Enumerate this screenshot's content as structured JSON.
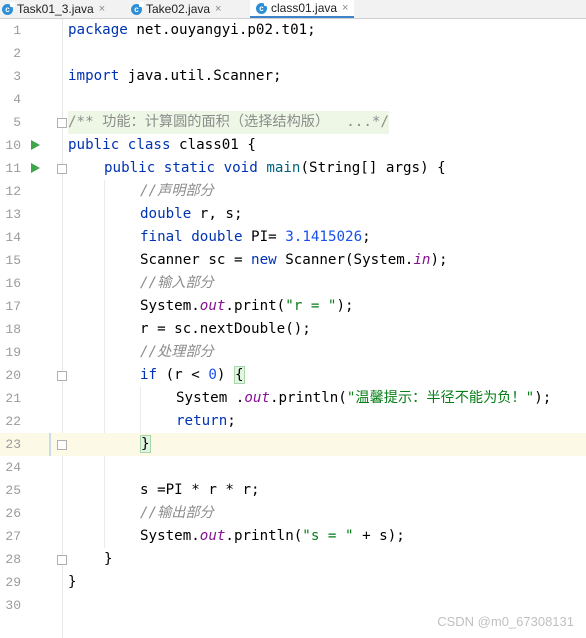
{
  "tabs": [
    {
      "label": "Task01_3.java",
      "icon": "java-class-icon",
      "active": false
    },
    {
      "label": "Take02.java",
      "icon": "java-class-icon",
      "active": false
    },
    {
      "label": "class01.java",
      "icon": "java-class-icon",
      "active": true
    }
  ],
  "tab_close_glyph": "×",
  "class_icon_glyph": "c",
  "lines": [
    {
      "n": "1"
    },
    {
      "n": "2"
    },
    {
      "n": "3"
    },
    {
      "n": "4"
    },
    {
      "n": "5"
    },
    {
      "n": "10"
    },
    {
      "n": "11"
    },
    {
      "n": "12"
    },
    {
      "n": "13"
    },
    {
      "n": "14"
    },
    {
      "n": "15"
    },
    {
      "n": "16"
    },
    {
      "n": "17"
    },
    {
      "n": "18"
    },
    {
      "n": "19"
    },
    {
      "n": "20"
    },
    {
      "n": "21"
    },
    {
      "n": "22"
    },
    {
      "n": "23"
    },
    {
      "n": "24"
    },
    {
      "n": "25"
    },
    {
      "n": "26"
    },
    {
      "n": "27"
    },
    {
      "n": "28"
    },
    {
      "n": "29"
    },
    {
      "n": "30"
    }
  ],
  "code": {
    "l1": {
      "kw": "package",
      "rest": " net.ouyangyi.p02.t01;"
    },
    "l3": {
      "kw": "import",
      "rest": " java.util.Scanner;"
    },
    "l5": {
      "text": "/** 功能：计算圆的面积（选择结构版）  ...*/"
    },
    "l10": {
      "kw1": "public",
      "kw2": "class",
      "rest": " class01 {"
    },
    "l11": {
      "kw1": "public",
      "kw2": "static",
      "kw3": "void",
      "method": "main",
      "rest": "(String[] args) {"
    },
    "l12": {
      "comment": "//声明部分"
    },
    "l13": {
      "kw": "double",
      "rest": " r, s;"
    },
    "l14": {
      "kw1": "final",
      "kw2": "double",
      "mid": " PI= ",
      "num": "3.1415026",
      "end": ";"
    },
    "l15": {
      "a": "Scanner sc = ",
      "kw": "new",
      "b": " Scanner(System.",
      "field": "in",
      "c": ");"
    },
    "l16": {
      "comment": "//输入部分"
    },
    "l17": {
      "a": "System.",
      "field": "out",
      "b": ".print(",
      "str": "\"r = \"",
      "c": ");"
    },
    "l18": {
      "text": "r = sc.nextDouble();"
    },
    "l19": {
      "comment": "//处理部分"
    },
    "l20": {
      "kw": "if",
      "a": " (r < ",
      "num": "0",
      "b": ") ",
      "brace": "{"
    },
    "l21": {
      "a": "System .",
      "field": "out",
      "b": ".println(",
      "str": "\"温馨提示：半径不能为负！\"",
      "c": ");"
    },
    "l22": {
      "kw": "return",
      "c": ";"
    },
    "l23": {
      "brace": "}"
    },
    "l25": {
      "text": "s =PI * r * r;"
    },
    "l26": {
      "comment": "//输出部分"
    },
    "l27": {
      "a": "System.",
      "field": "out",
      "b": ".println(",
      "str": "\"s = \"",
      "c": " + s);"
    },
    "l28": {
      "text": "}"
    },
    "l29": {
      "text": "}"
    }
  },
  "watermark": "CSDN @m0_67308131",
  "colors": {
    "keyword": "#0033b3",
    "comment": "#8c8c8c",
    "string": "#067d17",
    "number": "#1750eb",
    "field": "#871094",
    "run_icon": "#3fa64a",
    "active_tab_underline": "#4083c9"
  }
}
